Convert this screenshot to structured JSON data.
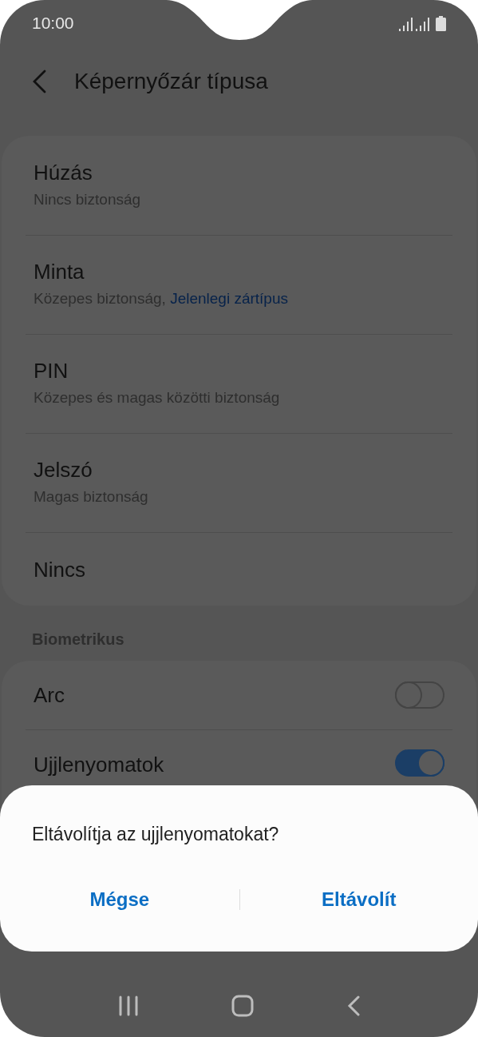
{
  "status_bar": {
    "time": "10:00"
  },
  "header": {
    "title": "Képernyőzár típusa"
  },
  "lock_types": [
    {
      "title": "Húzás",
      "subtitle": "Nincs biztonság"
    },
    {
      "title": "Minta",
      "subtitle": "Közepes biztonság,",
      "link": "Jelenlegi zártípus"
    },
    {
      "title": "PIN",
      "subtitle": "Közepes és magas közötti biztonság"
    },
    {
      "title": "Jelszó",
      "subtitle": "Magas biztonság"
    },
    {
      "title": "Nincs"
    }
  ],
  "biometrics": {
    "heading": "Biometrikus",
    "items": [
      {
        "title": "Arc",
        "on": false
      },
      {
        "title": "Ujjlenyomatok",
        "on": true
      }
    ]
  },
  "dialog": {
    "message": "Eltávolítja az ujjlenyomatokat?",
    "buttons": [
      "Mégse",
      "Eltávolít"
    ]
  }
}
